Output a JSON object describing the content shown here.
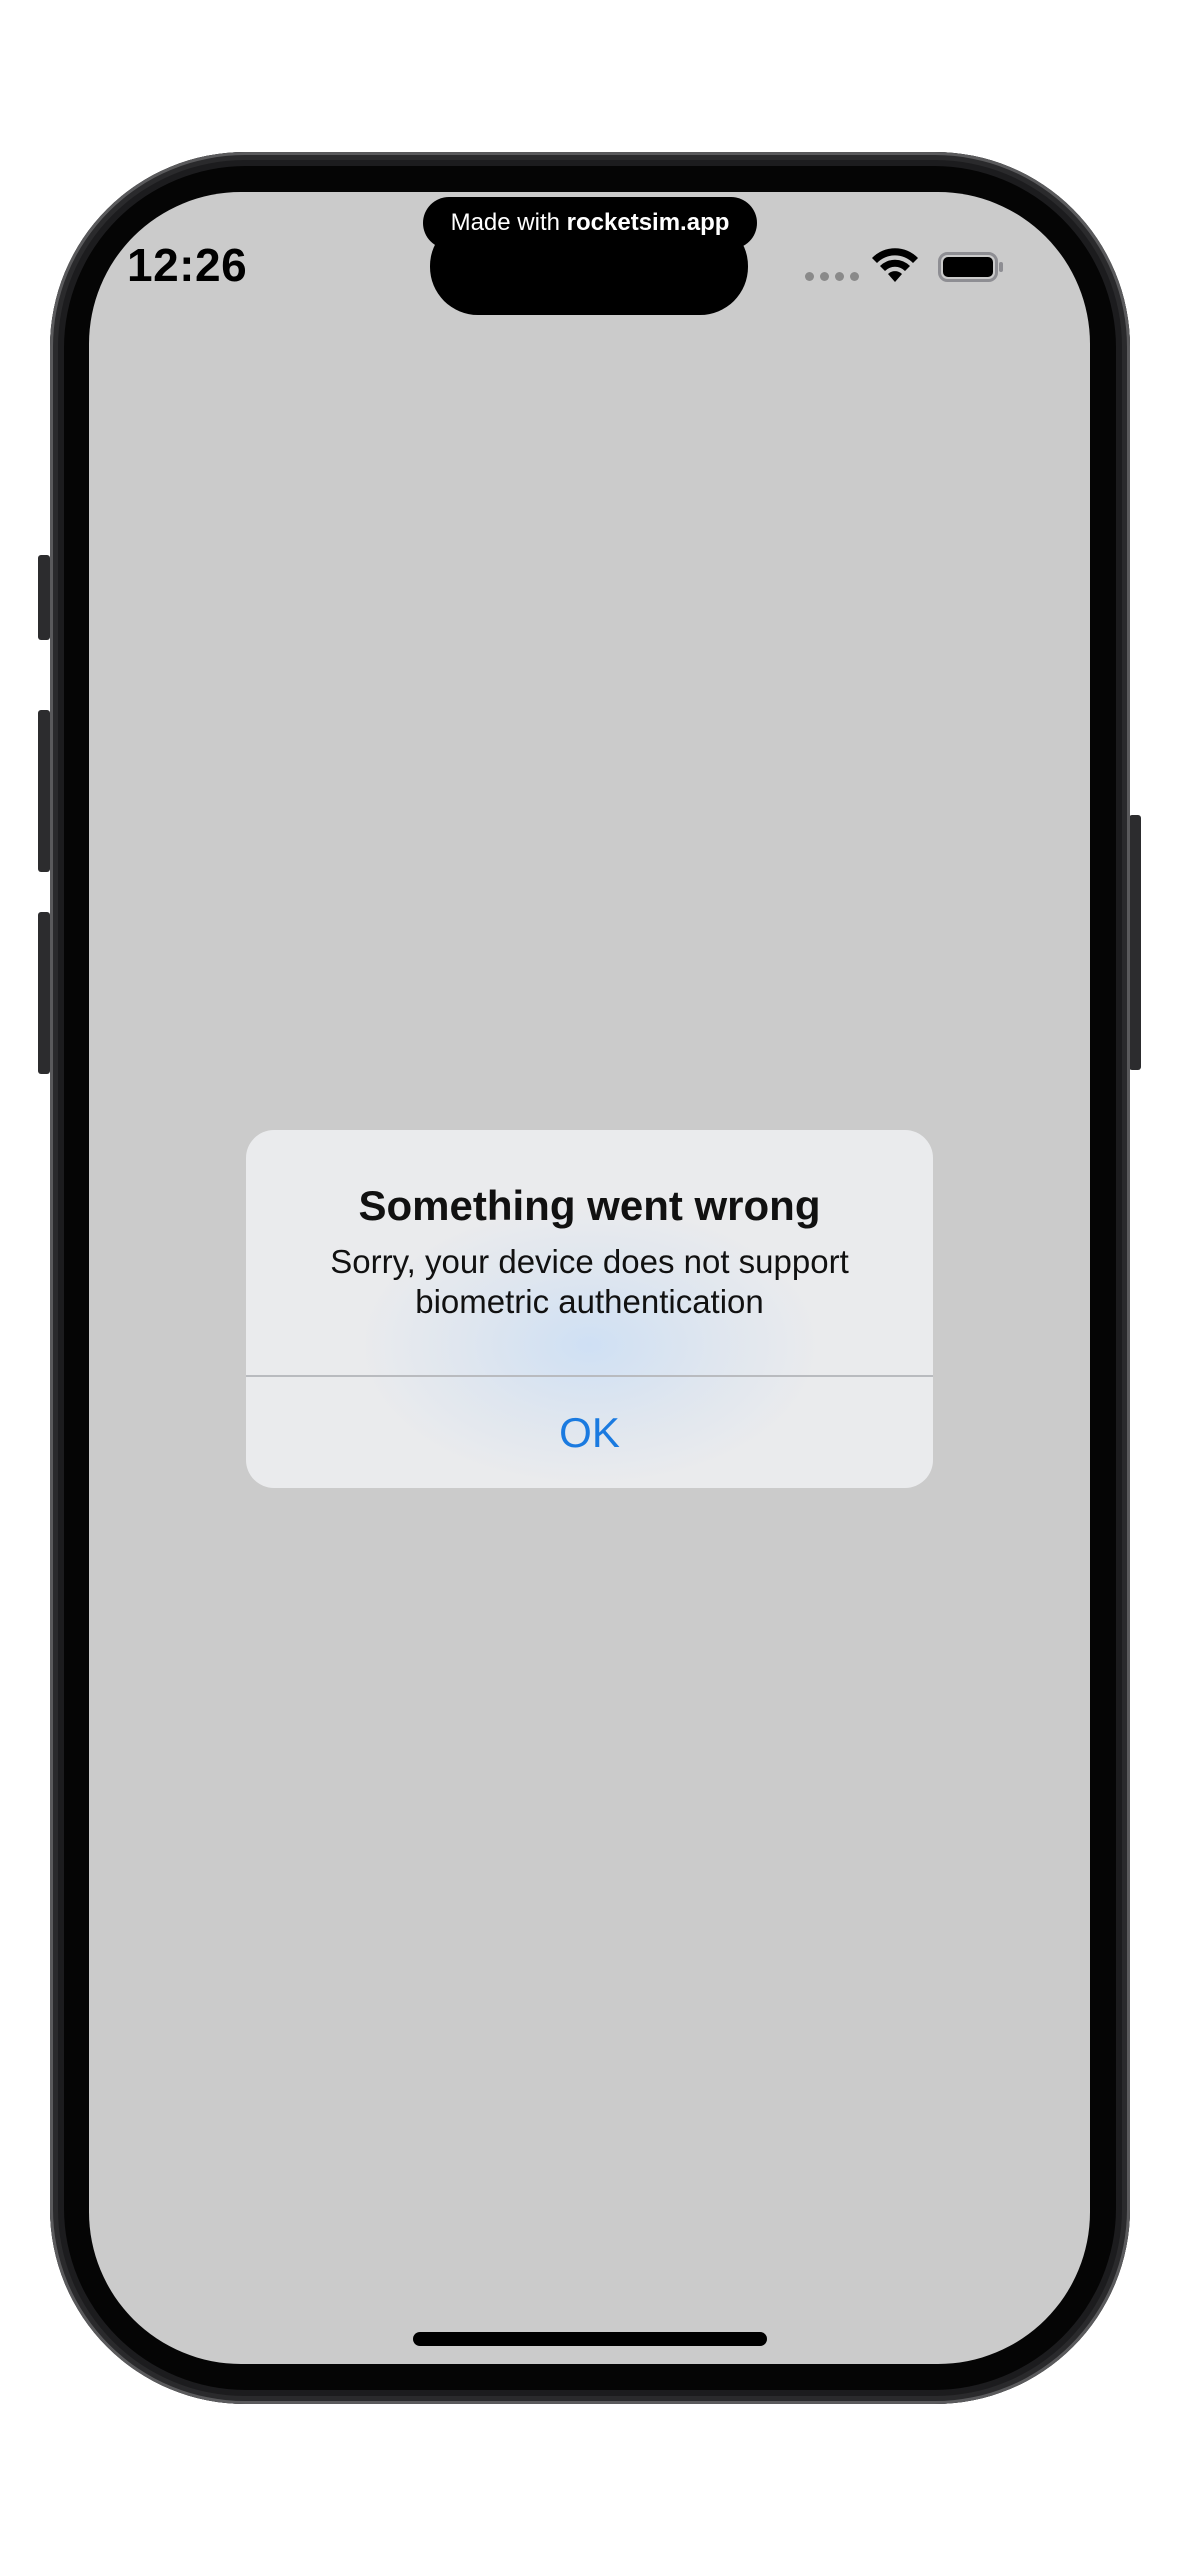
{
  "status_bar": {
    "time": "12:26",
    "signal_icon": "cellular-dots-icon",
    "wifi_icon": "wifi-icon",
    "battery_icon": "battery-icon"
  },
  "banner": {
    "prefix": "Made with ",
    "brand": "rocketsim.app"
  },
  "alert": {
    "title": "Something went wrong",
    "message": "Sorry, your device does not support biometric authentication",
    "ok_label": "OK"
  },
  "colors": {
    "screen_background": "#cbcbcb",
    "alert_background": "#eaebed",
    "accent": "#1a7ae0"
  }
}
